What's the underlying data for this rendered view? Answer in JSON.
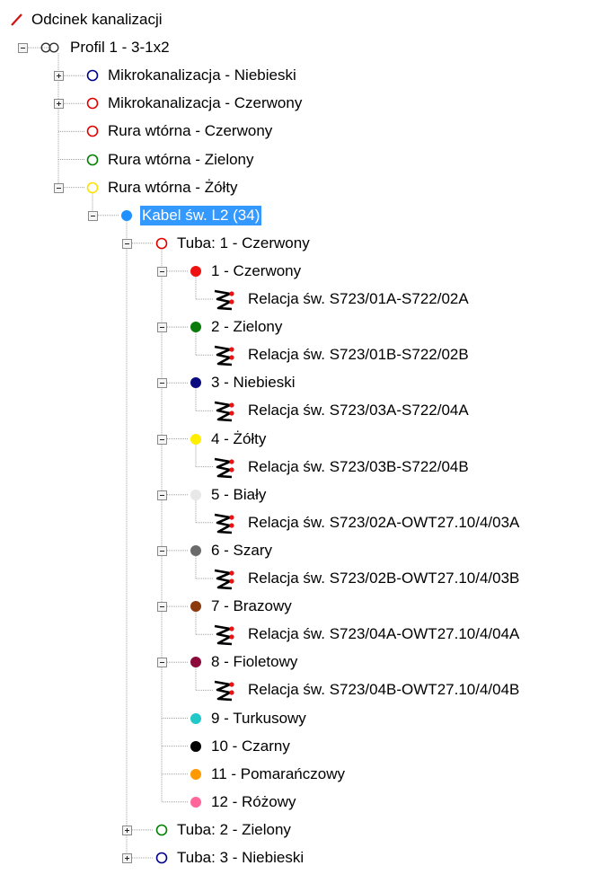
{
  "root": {
    "label": "Odcinek kanalizacji",
    "icon": "red-slash-line-icon",
    "color": "#d01010"
  },
  "profile": {
    "label": "Profil 1 - 3-1x2",
    "icon": "infinity-link-icon"
  },
  "ducts": [
    {
      "label": "Mikrokanalizacja - Niebieski",
      "color": "#00008b",
      "expanded": false
    },
    {
      "label": "Mikrokanalizacja - Czerwony",
      "color": "#e00000",
      "expanded": false
    },
    {
      "label": "Rura wtórna - Czerwony",
      "color": "#e00000"
    },
    {
      "label": "Rura wtórna - Zielony",
      "color": "#008000"
    },
    {
      "label": "Rura wtórna - Żółty",
      "color": "#ffe000",
      "expanded": true
    }
  ],
  "cable": {
    "label": "Kabel św. L2 (34)",
    "color": "#1e90ff",
    "selected": true
  },
  "tubes": [
    {
      "label": "Tuba: 1 - Czerwony",
      "color": "#e00000",
      "expanded": true
    },
    {
      "label": "Tuba: 2 - Zielony",
      "color": "#008000",
      "expanded": false
    },
    {
      "label": "Tuba: 3 - Niebieski",
      "color": "#00008b",
      "expanded": false
    }
  ],
  "fibers": [
    {
      "label": "1 - Czerwony",
      "color": "#ee1111",
      "relation": "Relacja św. S723/01A-S722/02A"
    },
    {
      "label": "2 - Zielony",
      "color": "#0a7a0a",
      "relation": "Relacja św. S723/01B-S722/02B"
    },
    {
      "label": "3 - Niebieski",
      "color": "#0a0a80",
      "relation": "Relacja św. S723/03A-S722/04A"
    },
    {
      "label": "4 - Żółty",
      "color": "#ffee00",
      "relation": "Relacja św. S723/03B-S722/04B"
    },
    {
      "label": "5 - Biały",
      "color": "#e8e8e8",
      "relation": "Relacja św. S723/02A-OWT27.10/4/03A"
    },
    {
      "label": "6 - Szary",
      "color": "#6a6a6a",
      "relation": "Relacja św. S723/02B-OWT27.10/4/03B"
    },
    {
      "label": "7 - Brazowy",
      "color": "#8b3a0e",
      "relation": "Relacja św. S723/04A-OWT27.10/4/04A"
    },
    {
      "label": "8 - Fioletowy",
      "color": "#8b0a3a",
      "relation": "Relacja św. S723/04B-OWT27.10/4/04B"
    },
    {
      "label": "9 - Turkusowy",
      "color": "#20c8c8"
    },
    {
      "label": "10 - Czarny",
      "color": "#000000"
    },
    {
      "label": "11 - Pomarańczowy",
      "color": "#ff9900"
    },
    {
      "label": "12 - Różowy",
      "color": "#ff6699"
    }
  ]
}
